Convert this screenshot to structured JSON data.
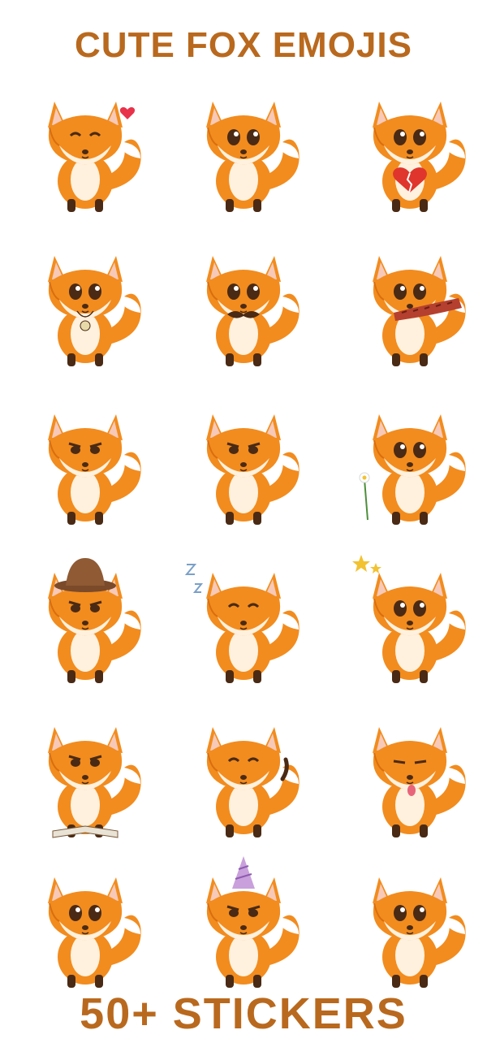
{
  "header": {
    "title": "CUTE FOX EMOJIS"
  },
  "footer": {
    "title": "50+ STICKERS"
  },
  "colors": {
    "title": "#B9691E",
    "fur": "#F28C1E",
    "fur_dark": "#D96E0E",
    "cream": "#FFF1DE",
    "ear_inner": "#F7C9B8",
    "dark": "#4A2A14",
    "background": "#FFFFFF"
  },
  "stickers": [
    {
      "name": "fox-blushing-heart",
      "extra": "heart",
      "mood": "happy"
    },
    {
      "name": "fox-sad-sitting",
      "extra": "none",
      "mood": "sad"
    },
    {
      "name": "fox-crying-broken-heart",
      "extra": "broken-heart",
      "mood": "crying"
    },
    {
      "name": "fox-with-medallion",
      "extra": "medallion",
      "mood": "proud"
    },
    {
      "name": "fox-mustache",
      "extra": "mustache",
      "mood": "big-eyes"
    },
    {
      "name": "fox-walking-scarf",
      "extra": "scarf",
      "mood": "walking"
    },
    {
      "name": "fox-side-sitting",
      "extra": "none",
      "mood": "smug"
    },
    {
      "name": "fox-grumpy-arms",
      "extra": "none",
      "mood": "grumpy"
    },
    {
      "name": "fox-smelling-flower",
      "extra": "flower",
      "mood": "curious"
    },
    {
      "name": "fox-brown-hat",
      "extra": "hat",
      "mood": "cool"
    },
    {
      "name": "fox-sleeping-hat",
      "extra": "sleep",
      "mood": "sleepy"
    },
    {
      "name": "fox-looking-stars",
      "extra": "stars",
      "mood": "dizzy"
    },
    {
      "name": "fox-book",
      "extra": "book",
      "mood": "angry"
    },
    {
      "name": "fox-waving",
      "extra": "wave",
      "mood": "happy"
    },
    {
      "name": "fox-tongue-out",
      "extra": "tongue",
      "mood": "silly"
    },
    {
      "name": "fox-surprised-sitting",
      "extra": "none",
      "mood": "surprised"
    },
    {
      "name": "fox-party-hat",
      "extra": "party-hat",
      "mood": "bored"
    },
    {
      "name": "fox-tall-ears",
      "extra": "none",
      "mood": "innocent"
    }
  ]
}
